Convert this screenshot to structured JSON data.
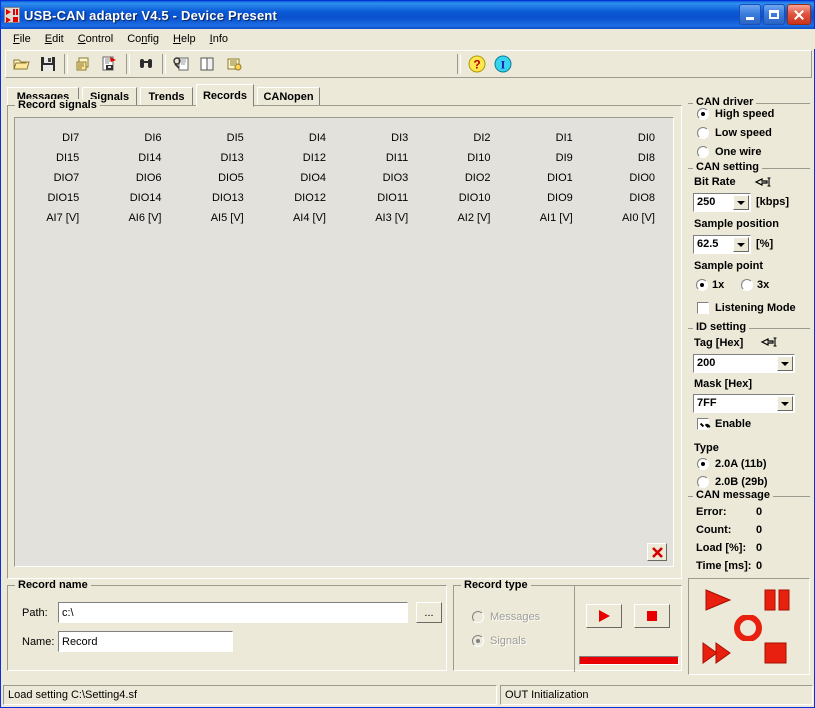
{
  "window": {
    "title": "USB-CAN adapter  V4.5  -  Device Present",
    "icon": "app-icon",
    "minimize": "–",
    "maximize": "□",
    "close": "✕"
  },
  "menu": [
    {
      "label": "File",
      "accel": "F"
    },
    {
      "label": "Edit",
      "accel": "E"
    },
    {
      "label": "Control",
      "accel": "C"
    },
    {
      "label": "Config",
      "accel": "n"
    },
    {
      "label": "Help",
      "accel": "H"
    },
    {
      "label": "Info",
      "accel": "I"
    }
  ],
  "toolbar": {
    "buttons": [
      {
        "name": "open-icon"
      },
      {
        "name": "save-icon"
      },
      {
        "name": "print-icon"
      },
      {
        "name": "save-as-icon"
      },
      {
        "name": "find-icon"
      },
      {
        "name": "settings-icon"
      },
      {
        "name": "copy-icon"
      },
      {
        "name": "report-icon"
      }
    ],
    "help_label": "?",
    "info_label": "I"
  },
  "tabs": [
    {
      "label": "Messages",
      "active": false
    },
    {
      "label": "Signals",
      "active": false
    },
    {
      "label": "Trends",
      "active": false
    },
    {
      "label": "Records",
      "active": true
    },
    {
      "label": "CANopen",
      "active": false
    }
  ],
  "record_signals": {
    "legend": "Record signals",
    "rows": [
      [
        "DI7",
        "DI6",
        "DI5",
        "DI4",
        "DI3",
        "DI2",
        "DI1",
        "DI0"
      ],
      [
        "DI15",
        "DI14",
        "DI13",
        "DI12",
        "DI11",
        "DI10",
        "DI9",
        "DI8"
      ],
      [
        "DIO7",
        "DIO6",
        "DIO5",
        "DIO4",
        "DIO3",
        "DIO2",
        "DIO1",
        "DIO0"
      ],
      [
        "DIO15",
        "DIO14",
        "DIO13",
        "DIO12",
        "DIO11",
        "DIO10",
        "DIO9",
        "DIO8"
      ],
      [
        "AI7 [V]",
        "AI6 [V]",
        "AI5 [V]",
        "AI4 [V]",
        "AI3 [V]",
        "AI2 [V]",
        "AI1 [V]",
        "AI0 [V]"
      ]
    ],
    "delete_label": "✖"
  },
  "record_name": {
    "legend": "Record name",
    "path_label": "Path:",
    "path_value": "c:\\",
    "name_label": "Name:",
    "name_value": "Record",
    "browse_label": "..."
  },
  "record_type": {
    "legend": "Record type",
    "options": [
      {
        "label": "Messages",
        "selected": false,
        "disabled": true
      },
      {
        "label": "Signals",
        "selected": true,
        "disabled": true
      }
    ],
    "play_icon": "play-icon",
    "stop_icon": "stop-icon",
    "progress_percent": 100
  },
  "can_driver": {
    "legend": "CAN driver",
    "options": [
      {
        "label": "High speed",
        "selected": true
      },
      {
        "label": "Low speed",
        "selected": false
      },
      {
        "label": "One wire",
        "selected": false
      }
    ]
  },
  "can_setting": {
    "legend": "CAN setting",
    "bit_rate_label": "Bit Rate",
    "bit_rate_value": "250",
    "bit_rate_unit": "[kbps]",
    "sample_position_label": "Sample position",
    "sample_position_value": "62.5",
    "sample_position_unit": "[%]",
    "sample_point_label": "Sample point",
    "sample_point_options": [
      {
        "label": "1x",
        "selected": true
      },
      {
        "label": "3x",
        "selected": false
      }
    ],
    "listening_mode_label": "Listening Mode",
    "listening_mode_checked": false
  },
  "id_setting": {
    "legend": "ID setting",
    "tag_label": "Tag [Hex]",
    "tag_value": "200",
    "mask_label": "Mask [Hex]",
    "mask_value": "7FF",
    "enable_label": "Enable",
    "enable_checked": true
  },
  "type_setting": {
    "legend": "Type",
    "options": [
      {
        "label": "2.0A (11b)",
        "selected": true
      },
      {
        "label": "2.0B (29b)",
        "selected": false
      }
    ]
  },
  "can_message": {
    "legend": "CAN message",
    "rows": [
      {
        "key": "Error:",
        "value": "0"
      },
      {
        "key": "Count:",
        "value": "0"
      },
      {
        "key": "Load [%]:",
        "value": "0"
      },
      {
        "key": "Time [ms]:",
        "value": "0"
      }
    ]
  },
  "media_controls": [
    {
      "name": "play-button"
    },
    {
      "name": "pause-button"
    },
    {
      "name": "record-button"
    },
    {
      "name": "fast-forward-button"
    },
    {
      "name": "stop-button"
    }
  ],
  "statusbar": {
    "left": "Load setting C:\\Setting4.sf",
    "right": "OUT Initialization"
  },
  "colors": {
    "accent_red": "#e80000",
    "title_blue": "#0a5ad6",
    "face": "#ece9d8"
  }
}
